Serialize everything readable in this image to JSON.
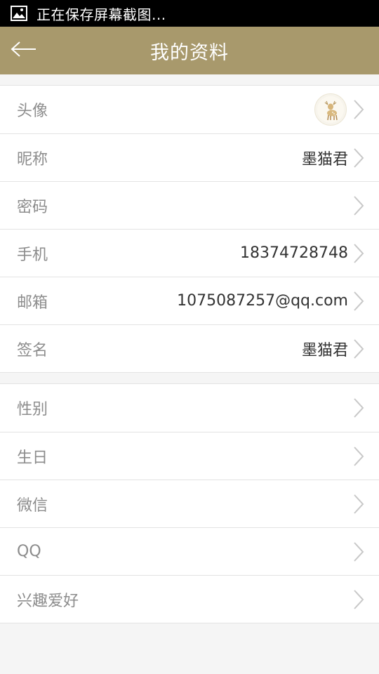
{
  "status_bar": {
    "icon": "image-icon",
    "text": "正在保存屏幕截图..."
  },
  "header": {
    "back_icon": "arrow-left-icon",
    "title": "我的资料",
    "background": "#a8996c"
  },
  "group1": {
    "rows": [
      {
        "label": "头像",
        "value": "",
        "has_avatar": true
      },
      {
        "label": "昵称",
        "value": "墨猫君"
      },
      {
        "label": "密码",
        "value": ""
      },
      {
        "label": "手机",
        "value": "18374728748"
      },
      {
        "label": "邮箱",
        "value": "1075087257@qq.com"
      },
      {
        "label": "签名",
        "value": "墨猫君"
      }
    ]
  },
  "group2": {
    "rows": [
      {
        "label": "性别",
        "value": ""
      },
      {
        "label": "生日",
        "value": ""
      },
      {
        "label": "微信",
        "value": ""
      },
      {
        "label": "QQ",
        "value": ""
      },
      {
        "label": "兴趣爱好",
        "value": ""
      }
    ]
  },
  "icons": {
    "chevron": "chevron-right-icon",
    "avatar": "deer-avatar"
  }
}
